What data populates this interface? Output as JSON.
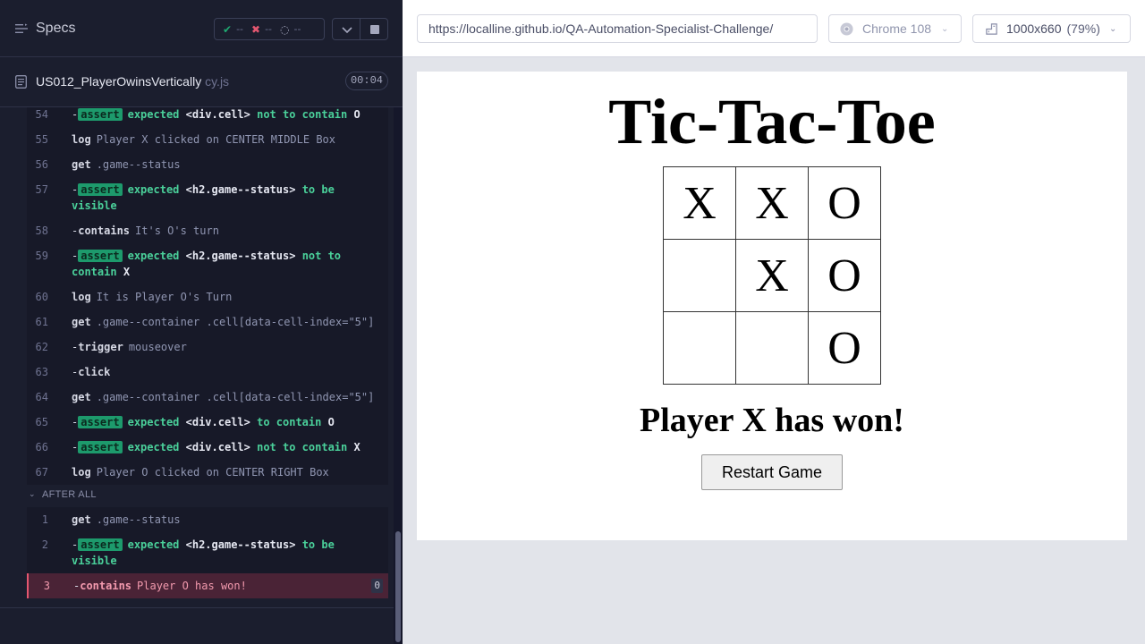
{
  "reporter": {
    "specs_label": "Specs",
    "stats": {
      "passed": "--",
      "failed": "--",
      "pending": "--"
    },
    "spec_name": "US012_PlayerOwinsVertically",
    "spec_ext": "cy.js",
    "duration": "00:04",
    "commands": [
      {
        "num": "54",
        "type": "assert",
        "child": true,
        "parts": [
          [
            "ok",
            "expected"
          ],
          [
            "code",
            "<div.cell>"
          ],
          [
            "ok",
            "not to contain"
          ],
          [
            "code",
            "O"
          ]
        ]
      },
      {
        "num": "55",
        "type": "cmd",
        "name": "log",
        "msg": "Player X clicked on CENTER MIDDLE Box"
      },
      {
        "num": "56",
        "type": "cmd",
        "name": "get",
        "msg": ".game--status"
      },
      {
        "num": "57",
        "type": "assert",
        "child": true,
        "parts": [
          [
            "ok",
            "expected"
          ],
          [
            "code",
            "<h2.game--status>"
          ],
          [
            "ok",
            "to be visible"
          ]
        ]
      },
      {
        "num": "58",
        "type": "cmd",
        "child": true,
        "name": "contains",
        "msg": "It's O's turn"
      },
      {
        "num": "59",
        "type": "assert",
        "child": true,
        "parts": [
          [
            "ok",
            "expected"
          ],
          [
            "code",
            "<h2.game--status>"
          ],
          [
            "ok",
            "not to contain"
          ],
          [
            "code",
            "X"
          ]
        ]
      },
      {
        "num": "60",
        "type": "cmd",
        "name": "log",
        "msg": "It is Player O's Turn"
      },
      {
        "num": "61",
        "type": "cmd",
        "name": "get",
        "msg": ".game--container .cell[data-cell-index=\"5\"]"
      },
      {
        "num": "62",
        "type": "cmd",
        "child": true,
        "name": "trigger",
        "msg": "mouseover"
      },
      {
        "num": "63",
        "type": "cmd",
        "child": true,
        "name": "click",
        "msg": ""
      },
      {
        "num": "64",
        "type": "cmd",
        "name": "get",
        "msg": ".game--container .cell[data-cell-index=\"5\"]"
      },
      {
        "num": "65",
        "type": "assert",
        "child": true,
        "parts": [
          [
            "ok",
            "expected"
          ],
          [
            "code",
            "<div.cell>"
          ],
          [
            "ok",
            "to contain"
          ],
          [
            "code",
            "O"
          ]
        ]
      },
      {
        "num": "66",
        "type": "assert",
        "child": true,
        "parts": [
          [
            "ok",
            "expected"
          ],
          [
            "code",
            "<div.cell>"
          ],
          [
            "ok",
            "not to contain"
          ],
          [
            "code",
            "X"
          ]
        ]
      },
      {
        "num": "67",
        "type": "cmd",
        "name": "log",
        "msg": "Player O clicked on CENTER RIGHT Box"
      }
    ],
    "hook_label": "AFTER ALL",
    "hook_commands": [
      {
        "num": "1",
        "type": "cmd",
        "name": "get",
        "msg": ".game--status"
      },
      {
        "num": "2",
        "type": "assert",
        "child": true,
        "parts": [
          [
            "ok",
            "expected"
          ],
          [
            "code",
            "<h2.game--status>"
          ],
          [
            "ok",
            "to be visible"
          ]
        ]
      },
      {
        "num": "3",
        "type": "cmd",
        "child": true,
        "fail": true,
        "name": "contains",
        "msg": "Player O has won!",
        "count": "0"
      }
    ],
    "assert_label": "assert"
  },
  "browser": {
    "url": "https://localline.github.io/QA-Automation-Specialist-Challenge/",
    "browser_name": "Chrome 108",
    "viewport": "1000x660",
    "zoom": "(79%)"
  },
  "game": {
    "title": "Tic-Tac-Toe",
    "cells": [
      "X",
      "X",
      "O",
      "",
      "X",
      "O",
      "",
      "",
      "O"
    ],
    "status": "Player X has won!",
    "restart_label": "Restart Game"
  }
}
